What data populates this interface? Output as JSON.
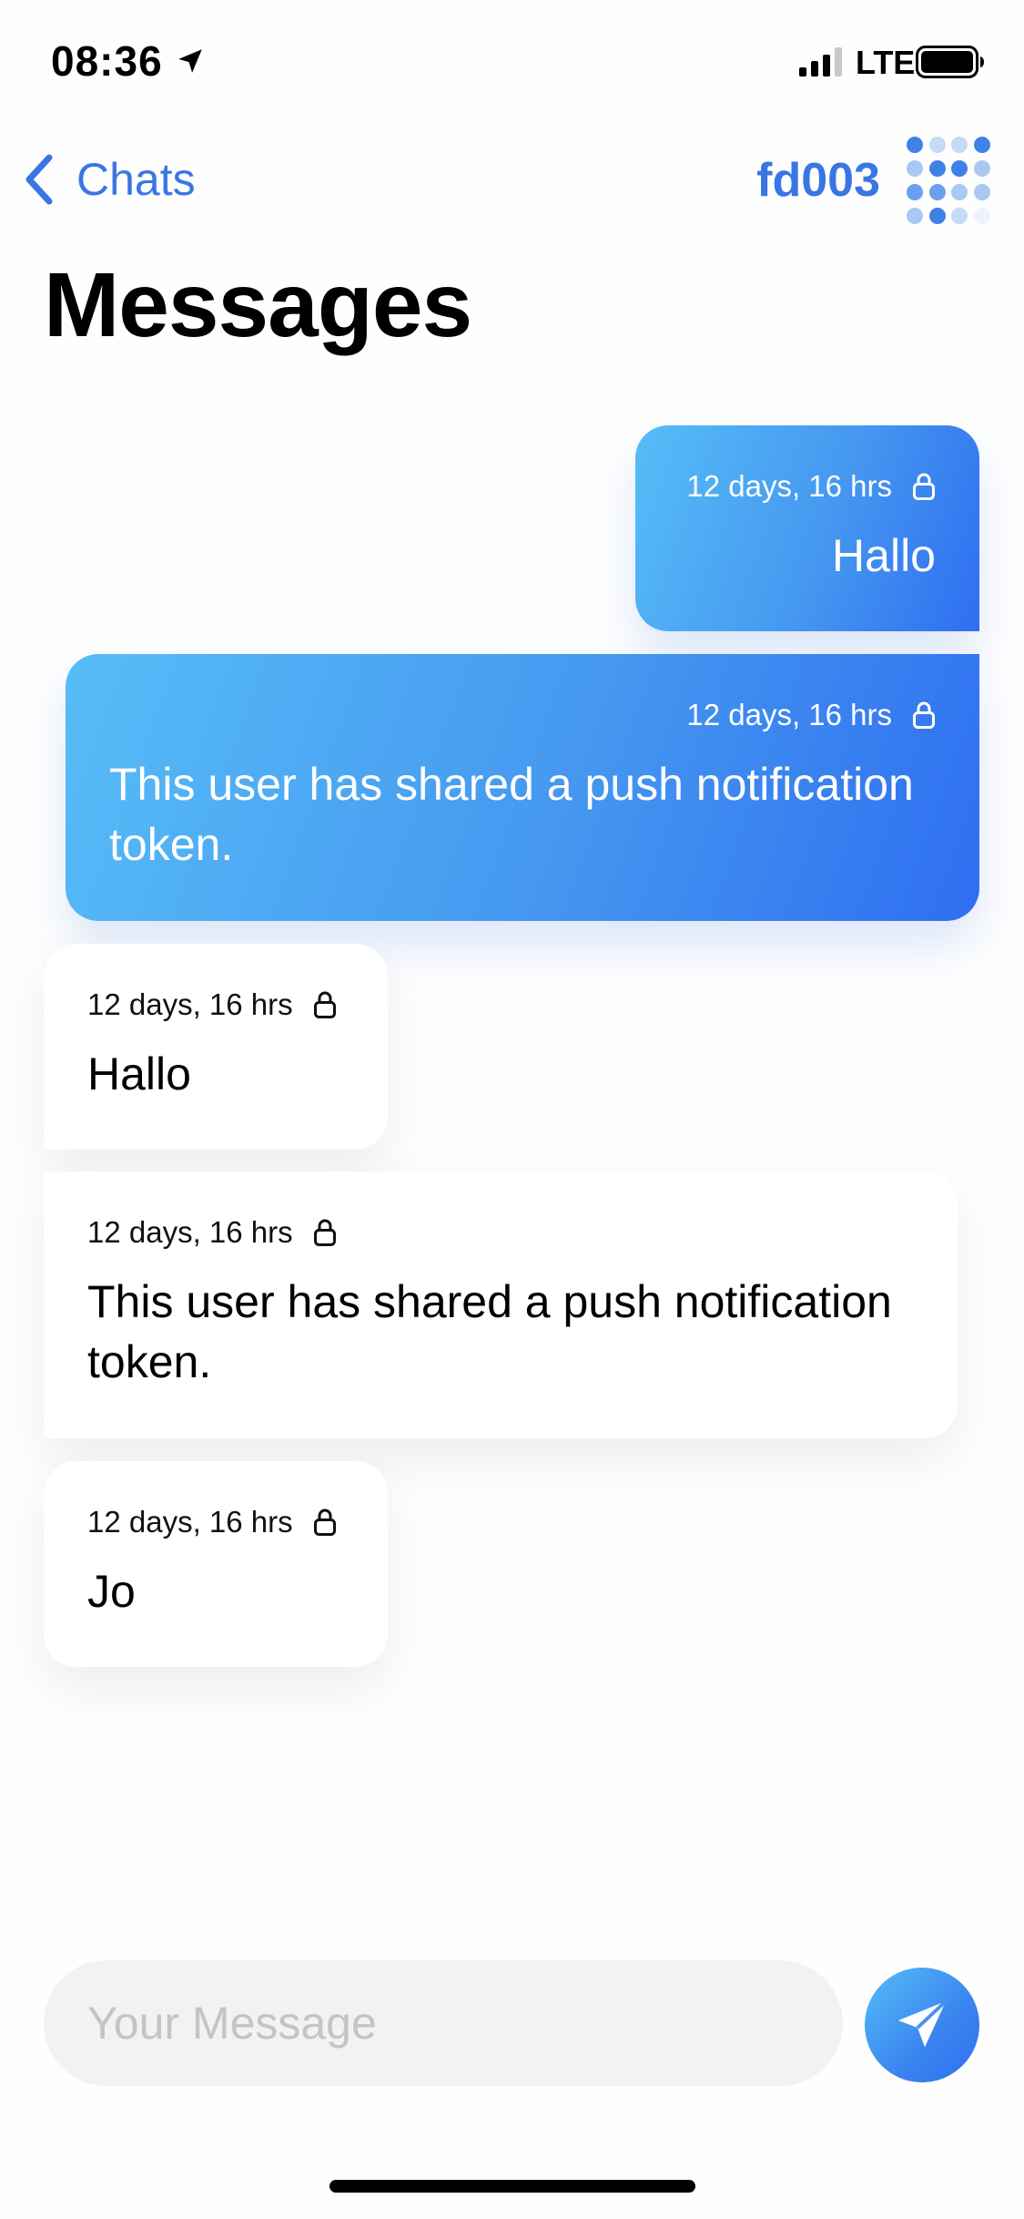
{
  "status_bar": {
    "time": "08:36",
    "network": "LTE"
  },
  "nav": {
    "back_label": "Chats",
    "contact_name": "fd003"
  },
  "page": {
    "title": "Messages"
  },
  "messages": [
    {
      "direction": "outgoing",
      "time": "12 days, 16 hrs",
      "text": "Hallo"
    },
    {
      "direction": "outgoing",
      "time": "12 days, 16 hrs",
      "text": "This user has shared a push notification token."
    },
    {
      "direction": "incoming",
      "time": "12 days, 16 hrs",
      "text": "Hallo"
    },
    {
      "direction": "incoming",
      "time": "12 days, 16 hrs",
      "text": "This user has shared a push notification token."
    },
    {
      "direction": "incoming",
      "time": "12 days, 16 hrs",
      "text": "Jo"
    }
  ],
  "composer": {
    "placeholder": "Your Message",
    "value": ""
  },
  "icons": {
    "location": "location-arrow-icon",
    "signal": "cellular-signal-icon",
    "battery": "battery-icon",
    "back": "chevron-left-icon",
    "avatar": "dot-grid-avatar-icon",
    "lock": "lock-icon",
    "send": "paper-plane-icon"
  },
  "colors": {
    "accent": "#3a76e3",
    "outgoing_gradient_start": "#56bdf7",
    "outgoing_gradient_end": "#2f6ef1",
    "input_background": "#f2f2f2"
  }
}
